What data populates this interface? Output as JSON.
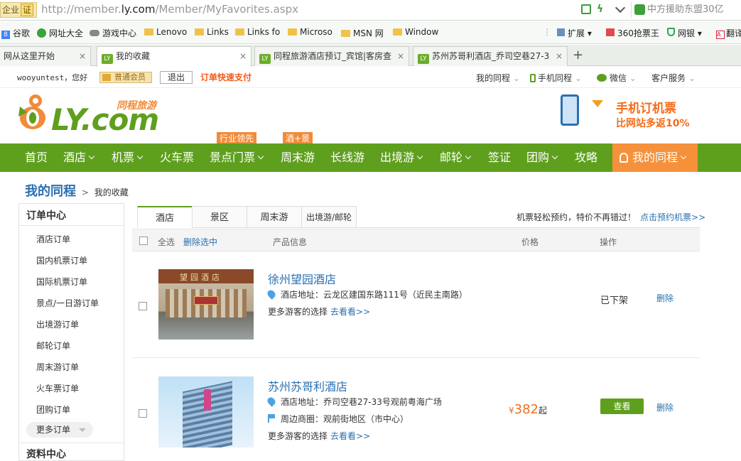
{
  "browser": {
    "security_label": "企业",
    "security_badge": "证",
    "url_prefix": "http://member.",
    "url_domain": "ly.com",
    "url_path": "/Member/MyFavorites.aspx",
    "search_text": "中方援助东盟30亿",
    "bookmarks": [
      "谷歌",
      "网址大全",
      "游戏中心",
      "Lenovo",
      "Links",
      "Links fo",
      "Microso",
      "MSN 网",
      "Window"
    ],
    "bookmarks_right": [
      "扩展",
      "360抢票王",
      "网银",
      "翻译"
    ],
    "tabs": [
      {
        "title": "网从这里开始"
      },
      {
        "title": "我的收藏"
      },
      {
        "title": "同程旅游酒店预订_宾馆|客房查"
      },
      {
        "title": "苏州苏哥利酒店_乔司空巷27-3"
      }
    ],
    "new_tab": "+",
    "close": "×"
  },
  "userbar": {
    "greeting": "wooyuntest，您好",
    "member_level": "普通会员",
    "logout": "退出",
    "quick_pay": "订单快速支付",
    "links": [
      "我的同程",
      "手机同程",
      "微信",
      "客户服务"
    ]
  },
  "header": {
    "logo_text": "LY.com",
    "logo_cn": "同程旅游",
    "promo_title": "手机订机票",
    "promo_sub": "比网站多返10%"
  },
  "nav": {
    "items": [
      "首页",
      "酒店",
      "机票",
      "火车票",
      "景点门票",
      "周末游",
      "长线游",
      "出境游",
      "邮轮",
      "签证",
      "团购",
      "攻略"
    ],
    "badges": [
      "行业领先",
      "酒+景"
    ],
    "my_tongcheng": "我的同程"
  },
  "breadcrumb": {
    "title": "我的同程",
    "sep": ">",
    "current": "我的收藏"
  },
  "sidebar": {
    "order_center": "订单中心",
    "orders": [
      "酒店订单",
      "国内机票订单",
      "国际机票订单",
      "景点/一日游订单",
      "出境游订单",
      "邮轮订单",
      "周末游订单",
      "火车票订单",
      "团购订单"
    ],
    "more_orders": "更多订单",
    "profile_center": "资料中心"
  },
  "content": {
    "tabs": [
      "酒店",
      "景区",
      "周末游",
      "出境游/邮轮"
    ],
    "promo_text": "机票轻松预约，特价不再错过！",
    "promo_link": "点击预约机票>>",
    "header": {
      "select_all": "全选",
      "delete_selected": "删除选中",
      "product": "产品信息",
      "price": "价格",
      "action": "操作"
    },
    "hotels": [
      {
        "name": "徐州望园酒店",
        "address_label": "酒店地址：",
        "address": "云龙区建国东路111号（近民主南路）",
        "more": "更多游客的选择",
        "more_link": "去看看>>",
        "status": "已下架",
        "delete": "删除",
        "img_text": "望园酒店"
      },
      {
        "name": "苏州苏哥利酒店",
        "address_label": "酒店地址：",
        "address": "乔司空巷27-33号观前粤海广场",
        "area_label": "周边商圈：",
        "area": "观前街地区（市中心）",
        "more": "更多游客的选择",
        "more_link": "去看看>>",
        "price_symbol": "¥",
        "price": "382",
        "price_suffix": "起",
        "view": "查看",
        "delete": "删除"
      }
    ]
  },
  "colors": {
    "brand_green": "#5f9f1e",
    "accent_orange": "#f5913a",
    "link_blue": "#2a6fb0",
    "price_orange": "#f06f1e"
  }
}
